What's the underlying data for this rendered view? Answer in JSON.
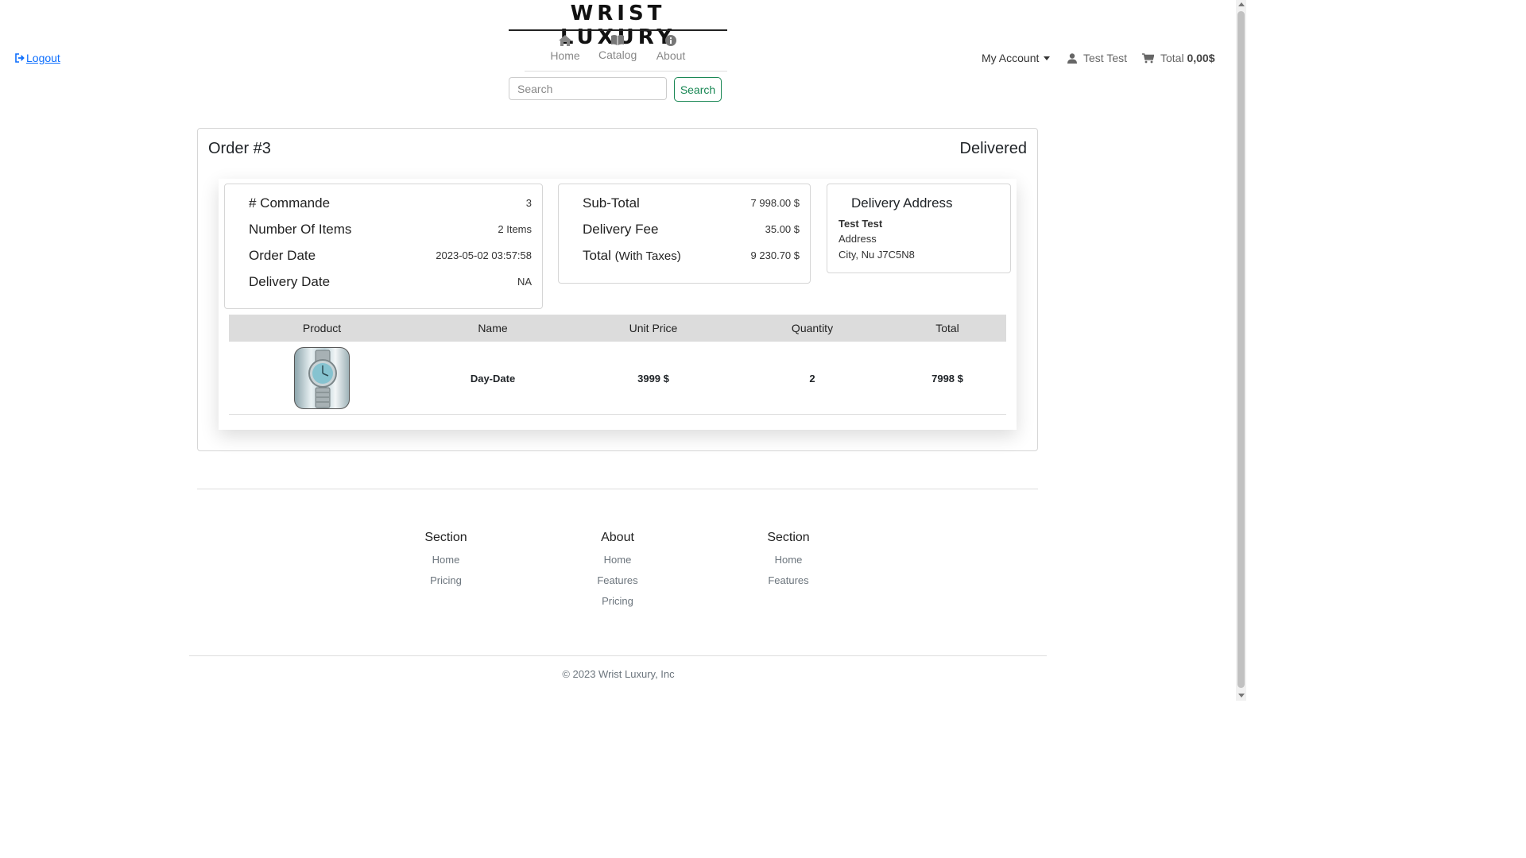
{
  "header": {
    "brand": "WRIST LUXURY",
    "nav": [
      {
        "label": "Home",
        "icon": "home-icon"
      },
      {
        "label": "Catalog",
        "icon": "book-icon"
      },
      {
        "label": "About",
        "icon": "info-icon"
      }
    ],
    "logout": "Logout",
    "account": "My Account",
    "user": "Test Test",
    "cart_label": "Total",
    "cart_total": "0,00$",
    "search": {
      "placeholder": "Search",
      "button": "Search"
    }
  },
  "order": {
    "title": "Order #3",
    "status": "Delivered",
    "summary": [
      {
        "label": "# Commande",
        "value": "3"
      },
      {
        "label": "Number Of Items",
        "value": "2 Items"
      },
      {
        "label": "Order Date",
        "value": "2023-05-02 03:57:58"
      },
      {
        "label": "Delivery Date",
        "value": "NA"
      }
    ],
    "totals": [
      {
        "label": "Sub-Total",
        "value": "7 998.00 $"
      },
      {
        "label": "Delivery Fee",
        "value": "35.00 $"
      },
      {
        "label": "Total",
        "label_suffix": "(With Taxes)",
        "value": "9 230.70 $"
      }
    ],
    "address": {
      "title": "Delivery Address",
      "name": "Test Test",
      "line1": "Address",
      "line2": "City, Nu J7C5N8"
    },
    "table": {
      "headers": [
        "Product",
        "Name",
        "Unit Price",
        "Quantity",
        "Total"
      ],
      "rows": [
        {
          "name": "Day-Date",
          "unit_price": "3999 $",
          "quantity": "2",
          "total": "7998 $"
        }
      ]
    }
  },
  "footer": {
    "columns": [
      {
        "title": "Section",
        "links": [
          "Home",
          "Pricing"
        ]
      },
      {
        "title": "About",
        "links": [
          "Home",
          "Features",
          "Pricing"
        ]
      },
      {
        "title": "Section",
        "links": [
          "Home",
          "Features"
        ]
      }
    ],
    "copyright": "© 2023 Wrist Luxury, Inc"
  },
  "colors": {
    "accent_link": "#0d6efd",
    "search_button": "#198754",
    "table_header": "#dcdcdc"
  }
}
